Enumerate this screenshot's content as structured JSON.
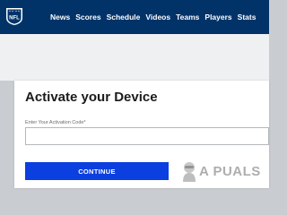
{
  "nav": {
    "logo_text": "NFL",
    "items": [
      "News",
      "Scores",
      "Schedule",
      "Videos",
      "Teams",
      "Players",
      "Stats"
    ]
  },
  "activation": {
    "title": "Activate your Device",
    "field_label": "Enter Your Activation Code*",
    "input_value": "",
    "button_label": "CONTINUE"
  },
  "watermark": {
    "text": "A PUALS"
  },
  "colors": {
    "nav_background": "#013369",
    "button_background": "#0b3fe0",
    "page_background": "#c9ccd0"
  }
}
